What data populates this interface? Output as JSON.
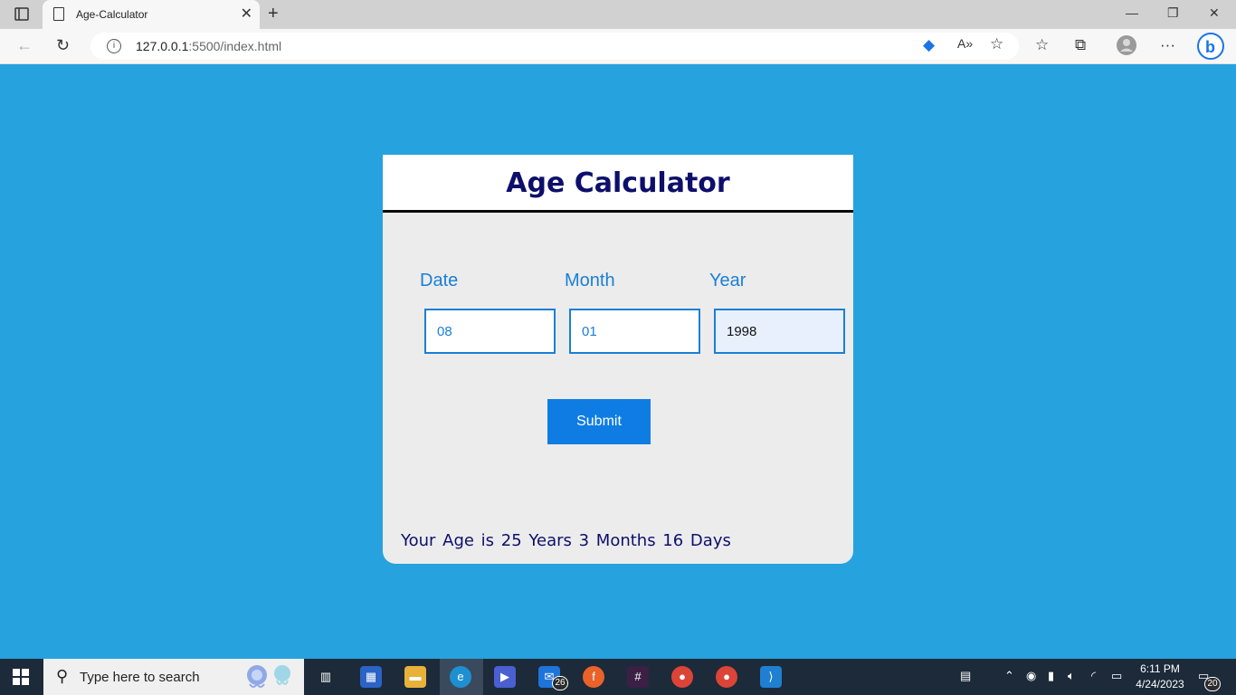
{
  "browser": {
    "tab_title": "Age-Calculator",
    "url_host": "127.0.0.1",
    "url_path": ":5500/index.html"
  },
  "app": {
    "heading": "Age Calculator",
    "labels": {
      "date": "Date",
      "month": "Month",
      "year": "Year"
    },
    "inputs": {
      "date": "08",
      "month": "01",
      "year": "1998"
    },
    "submit_label": "Submit",
    "result": "Your Age is 25 Years 3 Months 16 Days",
    "colors": {
      "page_bg": "#26a2df",
      "heading": "#0d0f6b",
      "accent": "#0f7ce3"
    }
  },
  "taskbar": {
    "search_placeholder": "Type here to search",
    "mail_badge": "26",
    "time": "6:11 PM",
    "date": "4/24/2023",
    "notification_count": "20"
  }
}
